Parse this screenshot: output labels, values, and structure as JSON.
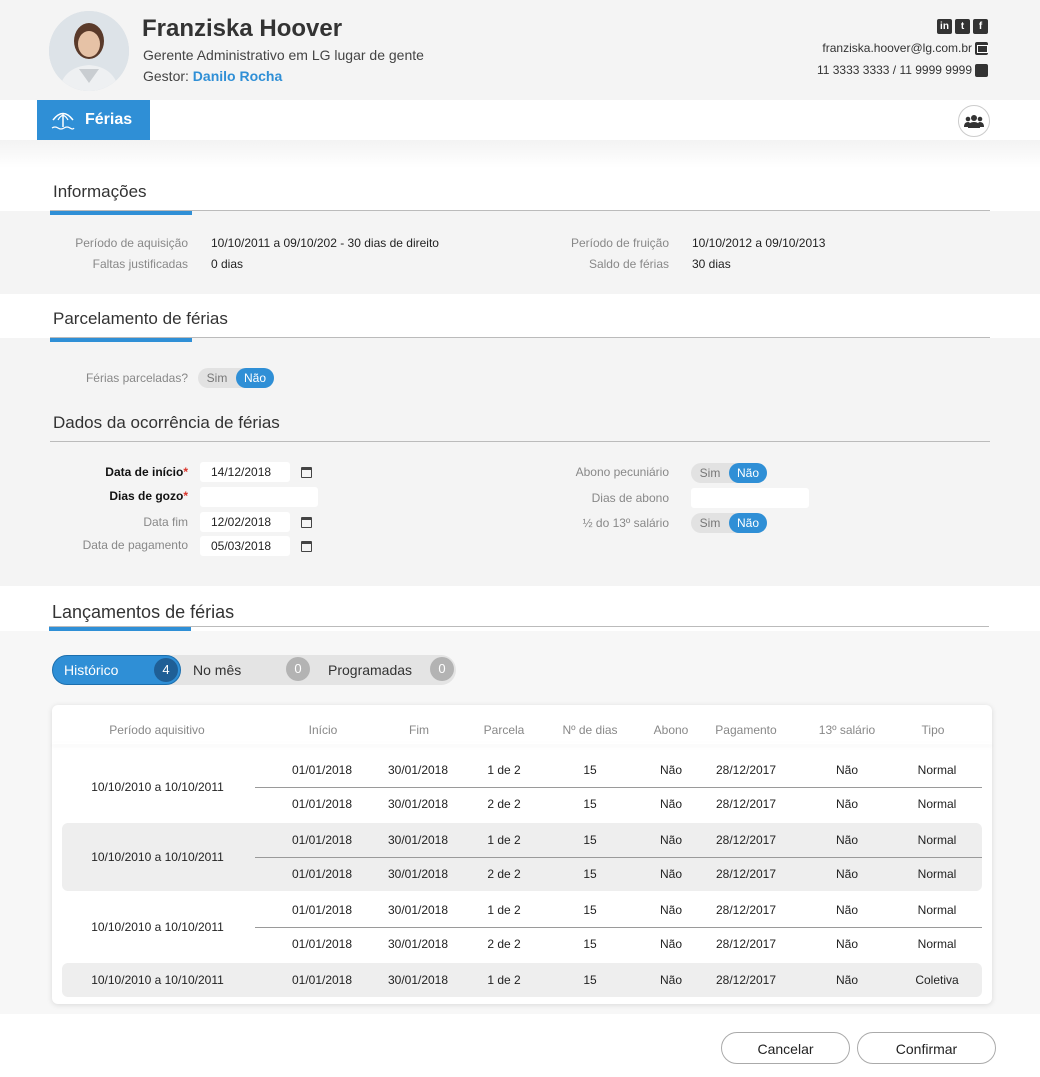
{
  "profile": {
    "name": "Franziska Hoover",
    "role": "Gerente Administrativo em LG lugar de gente",
    "manager_prefix": "Gestor: ",
    "manager_name": "Danilo Rocha",
    "email": "franziska.hoover@lg.com.br",
    "phone": "11 3333 3333 / 11 9999 9999"
  },
  "tab": {
    "label": "Férias"
  },
  "info": {
    "title": "Informações",
    "aquisicao_label": "Período de aquisição",
    "aquisicao_value": "10/10/2011 a 09/10/202 - 30 dias de direito",
    "faltas_label": "Faltas justificadas",
    "faltas_value": "0 dias",
    "fruicao_label": "Período de fruição",
    "fruicao_value": "10/10/2012 a 09/10/2013",
    "saldo_label": "Saldo de férias",
    "saldo_value": "30 dias"
  },
  "parcelamento": {
    "title": "Parcelamento de férias",
    "question": "Férias parceladas?",
    "yes": "Sim",
    "no": "Não"
  },
  "ocorrencia": {
    "title": "Dados da ocorrência de férias",
    "inicio_label": "Data de início",
    "inicio_value": "14/12/2018",
    "dias_label": "Dias de gozo",
    "dias_value": "",
    "fim_label": "Data fim",
    "fim_value": "12/02/2018",
    "pagamento_label": "Data de pagamento",
    "pagamento_value": "05/03/2018",
    "required_mark": "*",
    "abono_label": "Abono pecuniário",
    "dias_abono_label": "Dias de abono",
    "dias_abono_value": "",
    "decimo_label": "½ do 13º salário",
    "yes": "Sim",
    "no": "Não"
  },
  "lancamentos": {
    "title": "Lançamentos de férias",
    "filters": [
      {
        "label": "Histórico",
        "count": "4"
      },
      {
        "label": "No mês",
        "count": "0"
      },
      {
        "label": "Programadas",
        "count": "0"
      }
    ],
    "columns": [
      "Período aquisitivo",
      "Início",
      "Fim",
      "Parcela",
      "Nº de dias",
      "Abono",
      "Pagamento",
      "13º salário",
      "Tipo"
    ],
    "groups": [
      {
        "period": "10/10/2010 a 10/10/2011",
        "rows": [
          [
            "01/01/2018",
            "30/01/2018",
            "1 de 2",
            "15",
            "Não",
            "28/12/2017",
            "Não",
            "Normal"
          ],
          [
            "01/01/2018",
            "30/01/2018",
            "2 de 2",
            "15",
            "Não",
            "28/12/2017",
            "Não",
            "Normal"
          ]
        ]
      },
      {
        "period": "10/10/2010 a 10/10/2011",
        "rows": [
          [
            "01/01/2018",
            "30/01/2018",
            "1 de 2",
            "15",
            "Não",
            "28/12/2017",
            "Não",
            "Normal"
          ],
          [
            "01/01/2018",
            "30/01/2018",
            "2 de 2",
            "15",
            "Não",
            "28/12/2017",
            "Não",
            "Normal"
          ]
        ]
      },
      {
        "period": "10/10/2010 a 10/10/2011",
        "rows": [
          [
            "01/01/2018",
            "30/01/2018",
            "1 de 2",
            "15",
            "Não",
            "28/12/2017",
            "Não",
            "Normal"
          ],
          [
            "01/01/2018",
            "30/01/2018",
            "2 de 2",
            "15",
            "Não",
            "28/12/2017",
            "Não",
            "Normal"
          ]
        ]
      },
      {
        "period": "10/10/2010 a 10/10/2011",
        "rows": [
          [
            "01/01/2018",
            "30/01/2018",
            "1 de 2",
            "15",
            "Não",
            "28/12/2017",
            "Não",
            "Coletiva"
          ]
        ]
      }
    ]
  },
  "actions": {
    "cancel": "Cancelar",
    "confirm": "Confirmar"
  },
  "colors": {
    "accent": "#2f8fd6",
    "required": "#d9342b"
  }
}
